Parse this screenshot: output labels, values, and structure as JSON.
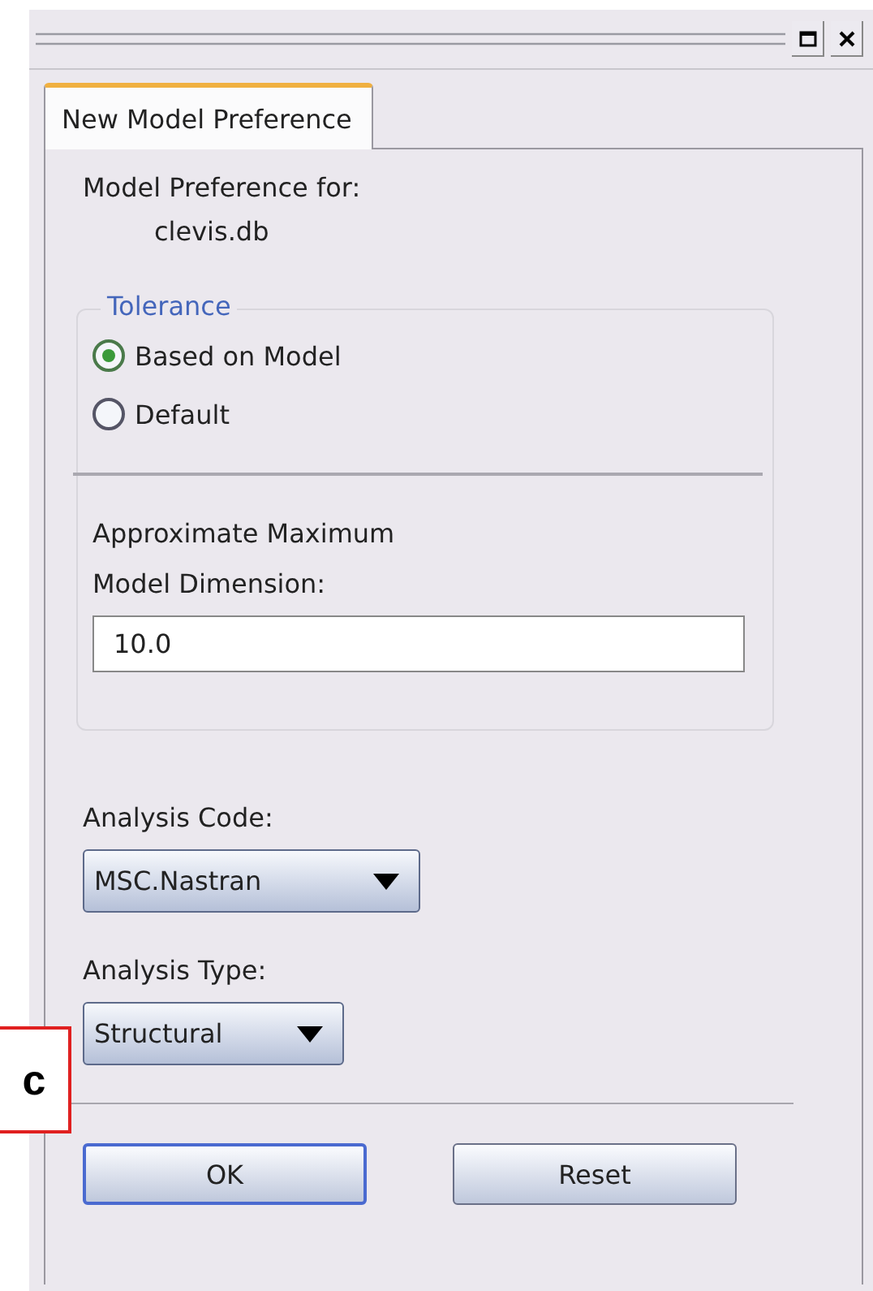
{
  "window": {
    "buttons": [
      {
        "kind": "maximize"
      },
      {
        "kind": "close"
      }
    ]
  },
  "tabs": [
    {
      "label": "New Model Preference",
      "selected": true
    }
  ],
  "model_preference": {
    "label": "Model Preference for:",
    "value": "clevis.db"
  },
  "tolerance": {
    "legend": "Tolerance",
    "options": [
      {
        "label": "Based on Model",
        "selected": true
      },
      {
        "label": "Default",
        "selected": false
      }
    ],
    "dimension_label": [
      "Approximate Maximum",
      "Model Dimension:"
    ],
    "dimension_value": "10.0"
  },
  "analysis_code": {
    "label": "Analysis Code:",
    "value": "MSC.Nastran"
  },
  "analysis_type": {
    "label": "Analysis Type:",
    "value": "Structural"
  },
  "buttons": [
    {
      "label": "OK",
      "default": true
    },
    {
      "label": "Reset",
      "default": false
    }
  ],
  "callout": {
    "label": "c"
  }
}
